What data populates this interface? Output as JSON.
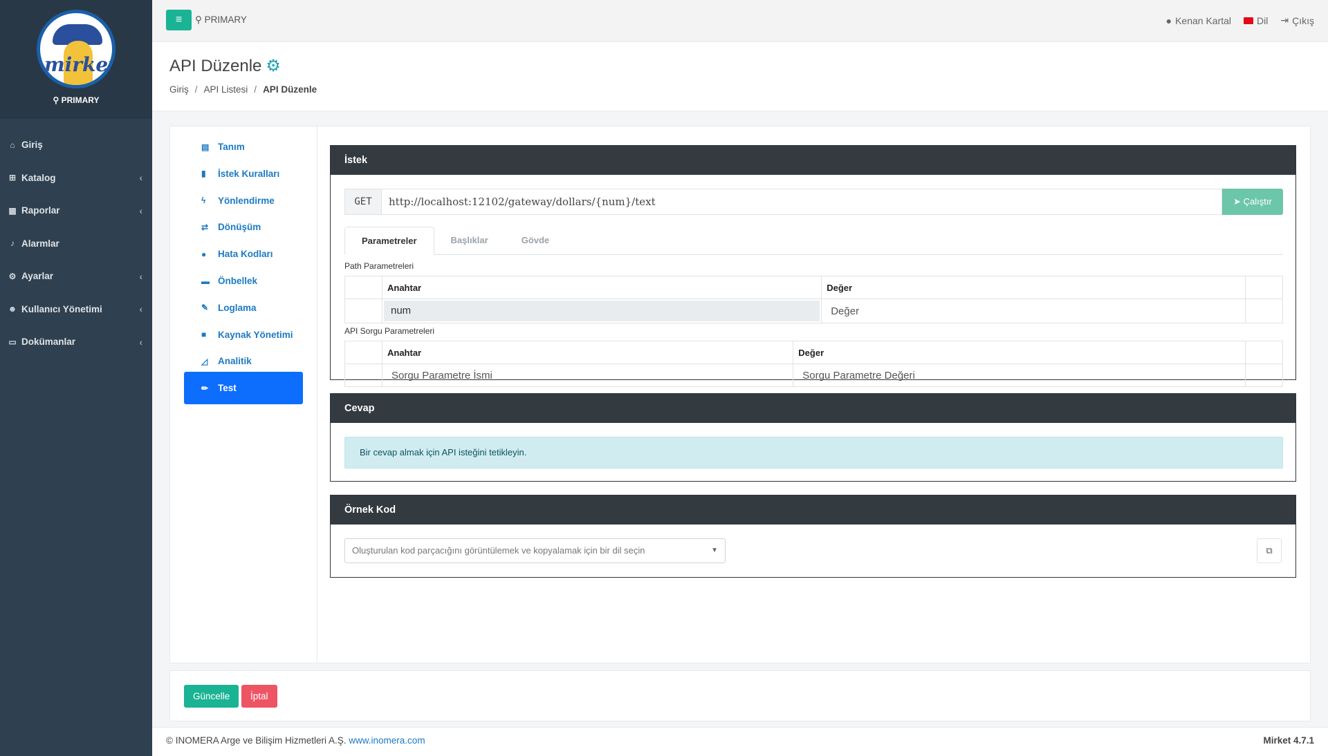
{
  "sidebar": {
    "brand_label": "PRIMARY",
    "logo_text": "mirket",
    "items": [
      {
        "icon": "home-icon",
        "glyph": "⌂",
        "label": "Giriş",
        "has_arrow": false
      },
      {
        "icon": "sitemap-icon",
        "glyph": "⊞",
        "label": "Katalog",
        "has_arrow": true
      },
      {
        "icon": "chart-icon",
        "glyph": "▦",
        "label": "Raporlar",
        "has_arrow": true
      },
      {
        "icon": "bell-icon",
        "glyph": "♪",
        "label": "Alarmlar",
        "has_arrow": false
      },
      {
        "icon": "cogs-icon",
        "glyph": "⚙",
        "label": "Ayarlar",
        "has_arrow": true
      },
      {
        "icon": "users-icon",
        "glyph": "☻",
        "label": "Kullanıcı Yönetimi",
        "has_arrow": true
      },
      {
        "icon": "file-icon",
        "glyph": "▭",
        "label": "Dokümanlar",
        "has_arrow": true
      }
    ],
    "arrow": "‹"
  },
  "topbar": {
    "menu_glyph": "≡",
    "environment": "PRIMARY",
    "user": "Kenan Kartal",
    "language": "Dil",
    "logout": "Çıkış"
  },
  "heading": {
    "title": "API Düzenle",
    "breadcrumb": [
      "Giriş",
      "API Listesi",
      "API Düzenle"
    ],
    "separator": "/"
  },
  "subnav": {
    "items": [
      {
        "icon": "id-card-icon",
        "glyph": "▤",
        "label": "Tanım"
      },
      {
        "icon": "book-icon",
        "glyph": "▮",
        "label": "İstek Kuralları"
      },
      {
        "icon": "bolt-icon",
        "glyph": "ϟ",
        "label": "Yönlendirme"
      },
      {
        "icon": "exchange-icon",
        "glyph": "⇄",
        "label": "Dönüşüm"
      },
      {
        "icon": "exclamation-icon",
        "glyph": "●",
        "label": "Hata Kodları"
      },
      {
        "icon": "memory-icon",
        "glyph": "▬",
        "label": "Önbellek"
      },
      {
        "icon": "feather-icon",
        "glyph": "✎",
        "label": "Loglama"
      },
      {
        "icon": "lock-icon",
        "glyph": "■",
        "label": "Kaynak Yönetimi"
      },
      {
        "icon": "area-chart-icon",
        "glyph": "◿",
        "label": "Analitik"
      },
      {
        "icon": "vial-icon",
        "glyph": "✏",
        "label": "Test"
      }
    ],
    "active_index": 9
  },
  "request": {
    "title": "İstek",
    "method": "GET",
    "url": "http://localhost:12102/gateway/dollars/{num}/text",
    "run_label": "Çalıştır",
    "run_glyph": "➤",
    "tabs": [
      "Parametreler",
      "Başlıklar",
      "Gövde"
    ],
    "active_tab": 0,
    "path_params_label": "Path Parametreleri",
    "query_params_label": "API Sorgu Parametreleri",
    "col_key": "Anahtar",
    "col_value": "Değer",
    "path_param_key": "num",
    "path_param_value_placeholder": "Değer",
    "query_key_placeholder": "Sorgu Parametre İsmi",
    "query_value_placeholder": "Sorgu Parametre Değeri"
  },
  "response": {
    "title": "Cevap",
    "message": "Bir cevap almak için API isteğini tetikleyin."
  },
  "sample_code": {
    "title": "Örnek Kod",
    "select_placeholder": "Oluşturulan kod parçacığını görüntülemek ve kopyalamak için bir dil seçin",
    "copy_glyph": "⧉"
  },
  "actions": {
    "update": "Güncelle",
    "cancel": "İptal"
  },
  "footer": {
    "copyright": "© INOMERA Arge ve Bilişim Hizmetleri A.Ş.",
    "link": "www.inomera.com",
    "version": "Mirket 4.7.1"
  },
  "colors": {
    "sidebar": "#2f4050",
    "primary_green": "#1ab394",
    "danger": "#ed5565",
    "active_blue": "#0d6efd",
    "link_blue": "#1c7ac2"
  }
}
